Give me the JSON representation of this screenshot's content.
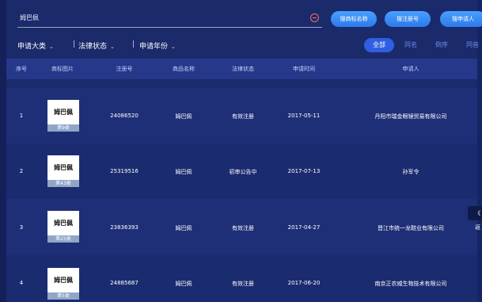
{
  "search": {
    "query": "姆巴佩"
  },
  "buttons": {
    "by_name": "搜商标名称",
    "by_reg": "搜注册号",
    "by_applicant": "搜申请人"
  },
  "filters": {
    "category": "申请大类",
    "status": "法律状态",
    "year": "申请年份",
    "separator": "|"
  },
  "segments": {
    "all": "全部",
    "same": "同名",
    "inverse": "倒序",
    "near": "同音"
  },
  "table": {
    "headers": {
      "no": "序号",
      "image": "商标图片",
      "reg": "注册号",
      "name": "商品名称",
      "status": "法律状态",
      "date": "申请时间",
      "applicant": "申请人"
    },
    "rows": [
      {
        "no": "1",
        "logo_text": "姆巴佩",
        "class_label": "第9类",
        "reg": "24086520",
        "name": "姆巴佩",
        "status": "有效注册",
        "date": "2017-05-11",
        "applicant": "丹阳市瑞金眼镜贸易有限公司"
      },
      {
        "no": "2",
        "logo_text": "姆巴佩",
        "class_label": "第43类",
        "reg": "25319516",
        "name": "姆巴佩",
        "status": "初审公告中",
        "date": "2017-07-13",
        "applicant": "孙军令"
      },
      {
        "no": "3",
        "logo_text": "姆巴佩",
        "class_label": "第25类",
        "reg": "23836393",
        "name": "姆巴佩",
        "status": "有效注册",
        "date": "2017-04-27",
        "applicant": "晋江市统一龙鞋业有限公司"
      },
      {
        "no": "4",
        "logo_text": "姆巴佩",
        "class_label": "第5类",
        "reg": "24885687",
        "name": "姆巴佩",
        "status": "有效注册",
        "date": "2017-06-20",
        "applicant": "南京正农威生物技术有限公司"
      }
    ]
  },
  "side_tab": {
    "label": "《 返"
  },
  "icons": {
    "clear": "clear-icon",
    "chevron": "chevron-down-icon"
  },
  "colors": {
    "background": "#1b2a6b",
    "accent": "#2f5fe0",
    "button": "#3a8cff",
    "clear": "#ff6a6a"
  }
}
